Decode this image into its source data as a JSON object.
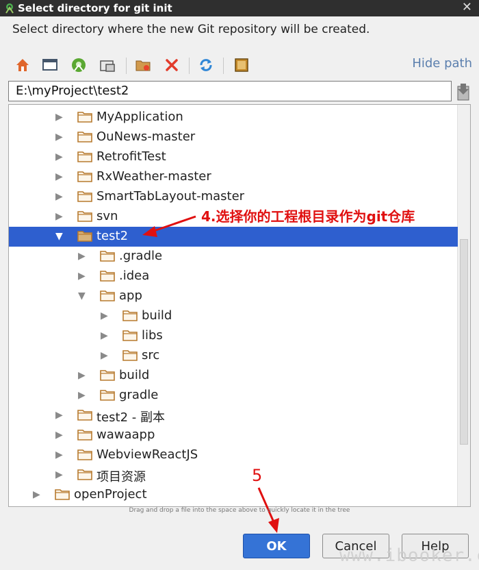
{
  "window": {
    "title": "Select directory for git init",
    "close_glyph": "✕"
  },
  "description": "Select directory where the new Git repository will be created.",
  "toolbar": {
    "buttons": [
      "home-icon",
      "desktop-icon",
      "project-icon",
      "module-icon",
      "new-folder-icon",
      "delete-icon",
      "refresh-icon",
      "show-hidden-icon"
    ],
    "hide_path_label": "Hide path"
  },
  "path_field": {
    "value": "E:\\myProject\\test2"
  },
  "tree": {
    "rows": [
      {
        "label": "MyApplication",
        "level": 2,
        "expanded": false,
        "selected": false
      },
      {
        "label": "OuNews-master",
        "level": 2,
        "expanded": false,
        "selected": false
      },
      {
        "label": "RetrofitTest",
        "level": 2,
        "expanded": false,
        "selected": false
      },
      {
        "label": "RxWeather-master",
        "level": 2,
        "expanded": false,
        "selected": false
      },
      {
        "label": "SmartTabLayout-master",
        "level": 2,
        "expanded": false,
        "selected": false
      },
      {
        "label": "svn",
        "level": 2,
        "expanded": false,
        "selected": false
      },
      {
        "label": "test2",
        "level": 2,
        "expanded": true,
        "selected": true
      },
      {
        "label": ".gradle",
        "level": 3,
        "expanded": false,
        "selected": false
      },
      {
        "label": ".idea",
        "level": 3,
        "expanded": false,
        "selected": false
      },
      {
        "label": "app",
        "level": 3,
        "expanded": true,
        "selected": false
      },
      {
        "label": "build",
        "level": 4,
        "expanded": false,
        "selected": false
      },
      {
        "label": "libs",
        "level": 4,
        "expanded": false,
        "selected": false
      },
      {
        "label": "src",
        "level": 4,
        "expanded": false,
        "selected": false
      },
      {
        "label": "build",
        "level": 3,
        "expanded": false,
        "selected": false
      },
      {
        "label": "gradle",
        "level": 3,
        "expanded": false,
        "selected": false
      },
      {
        "label": "test2 - 副本",
        "level": 2,
        "expanded": false,
        "selected": false
      },
      {
        "label": "wawaapp",
        "level": 2,
        "expanded": false,
        "selected": false
      },
      {
        "label": "WebviewReactJS",
        "level": 2,
        "expanded": false,
        "selected": false
      },
      {
        "label": "项目资源",
        "level": 2,
        "expanded": false,
        "selected": false
      },
      {
        "label": "openProject",
        "level": 1,
        "expanded": false,
        "selected": false
      }
    ]
  },
  "annotation": {
    "text": "4.选择你的工程根目录作为git仓库",
    "color": "#e01010"
  },
  "step_marker": {
    "text": "5",
    "color": "#e01010"
  },
  "drag_hint": "Drag and drop a file into the space above to quickly locate it in the tree",
  "buttons": {
    "ok": "OK",
    "cancel": "Cancel",
    "help": "Help"
  },
  "watermark": "www.ibooker.cc",
  "colors": {
    "selection": "#2e5fcf",
    "ok_button": "#3573d6",
    "folder": "#b77a2e",
    "link": "#5b7fae"
  }
}
